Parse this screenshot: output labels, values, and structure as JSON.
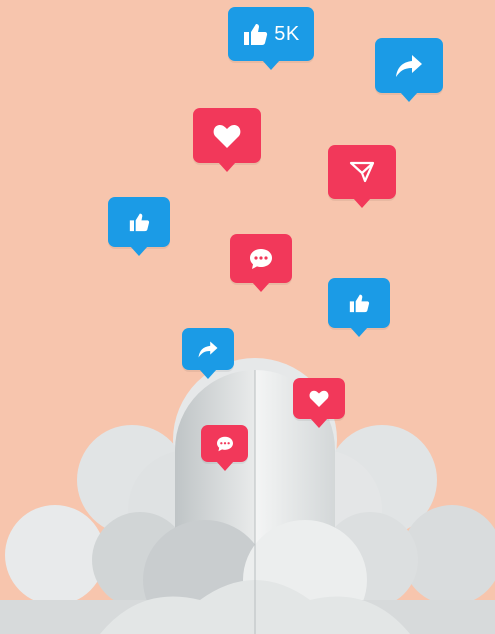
{
  "background_color": "#f7c5ad",
  "colors": {
    "like_blue": "#1b9be6",
    "heart_red": "#f2385a",
    "cloud_light": "#eef0f0",
    "cloud_shadow": "#c9cdcf"
  },
  "reactions": {
    "top_like": {
      "icon": "thumbs-up-icon",
      "count": "5K"
    },
    "icons": [
      "share-icon",
      "heart-icon",
      "send-icon",
      "thumbs-up-icon",
      "comment-icon"
    ]
  }
}
